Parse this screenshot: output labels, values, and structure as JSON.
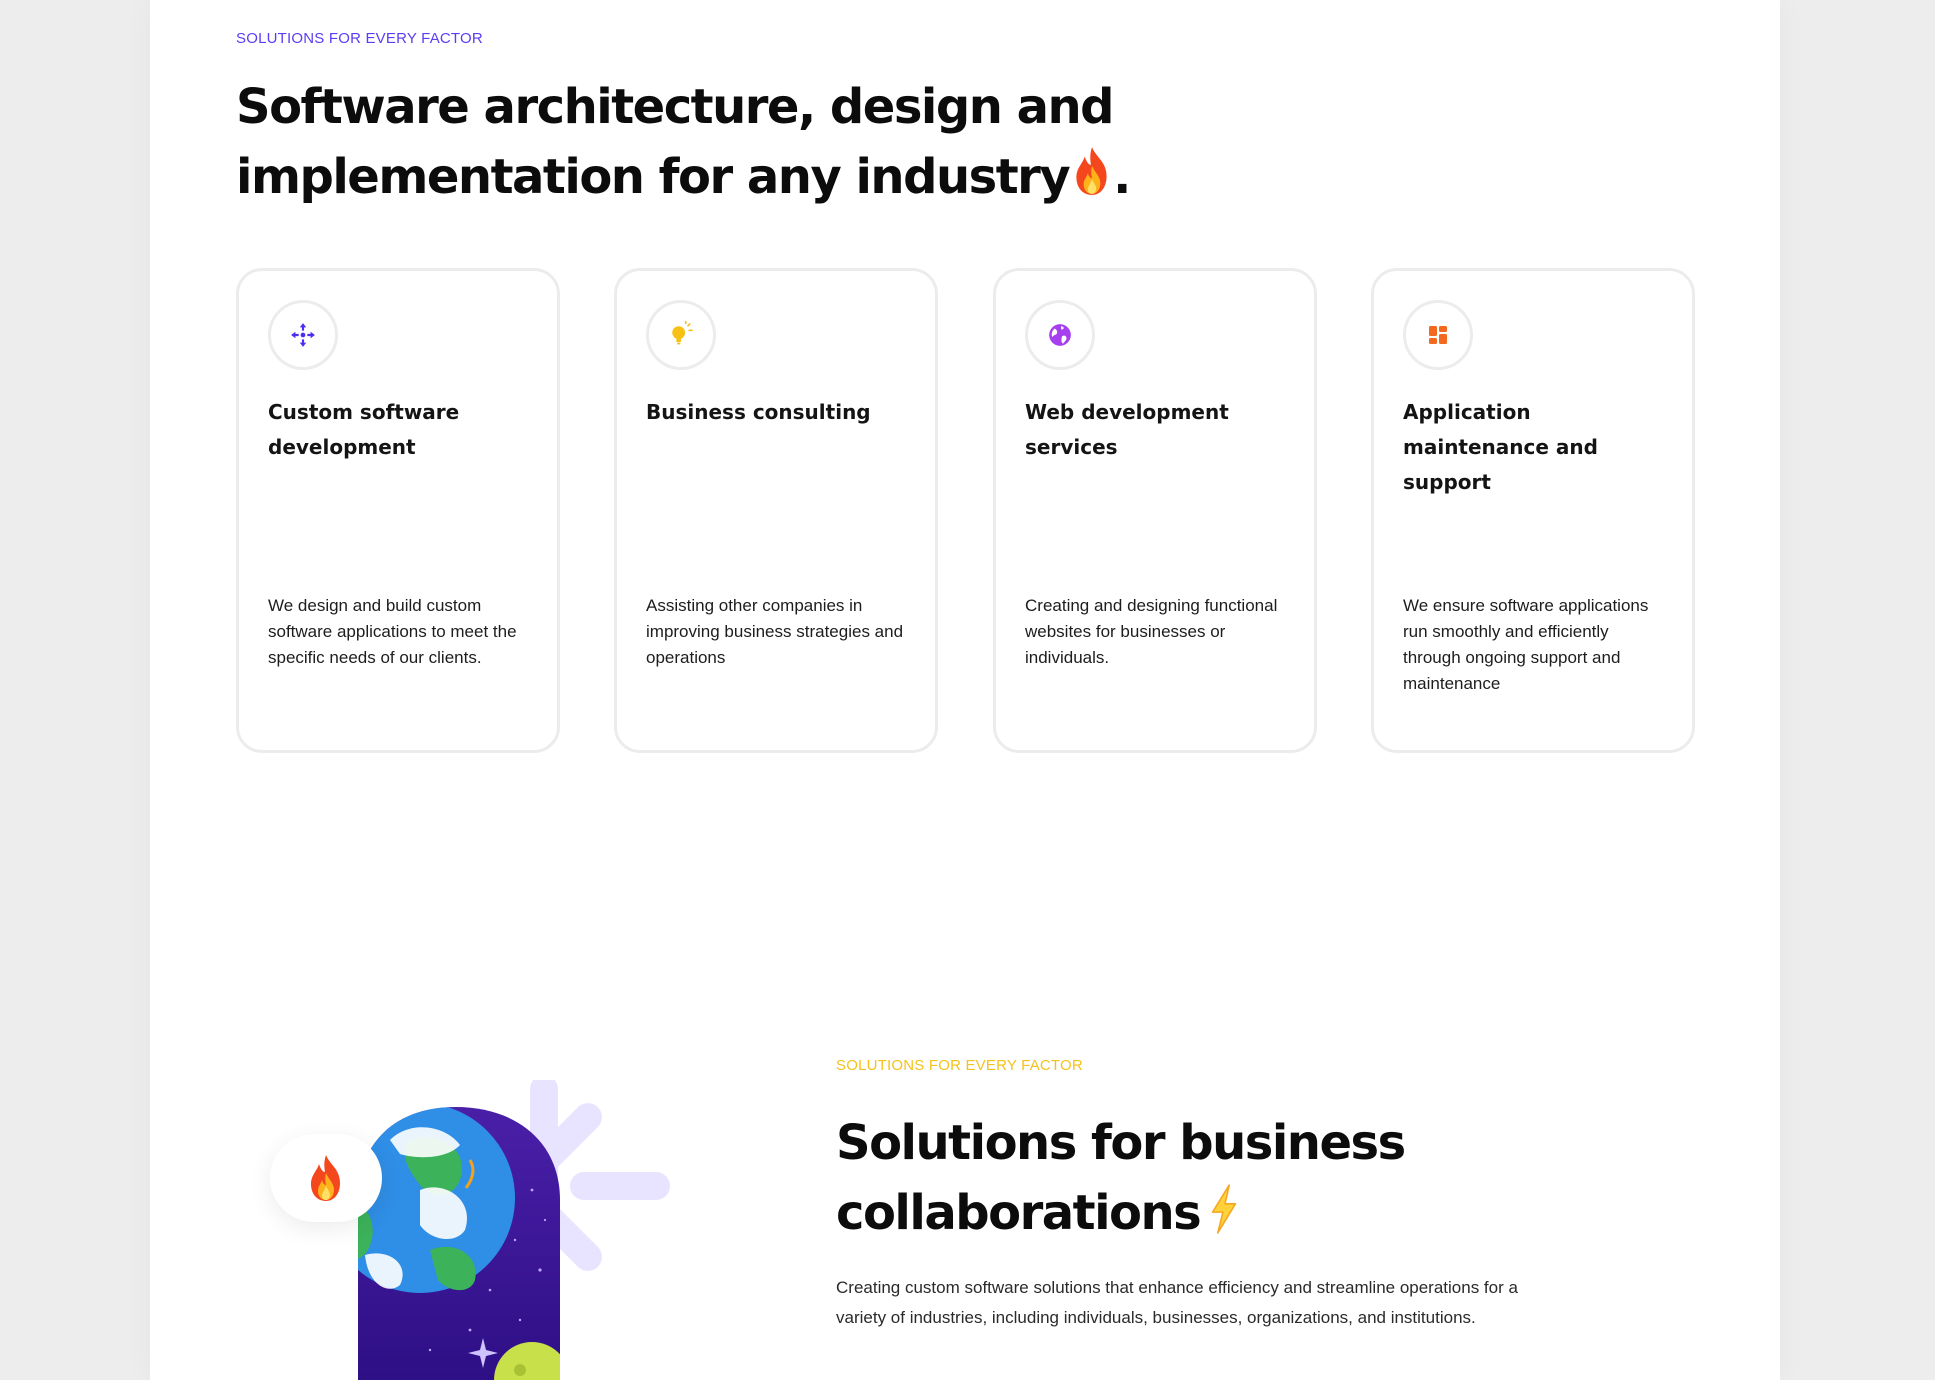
{
  "section1": {
    "eyebrow": "SOLUTIONS FOR EVERY FACTOR",
    "headline": "Software architecture, design and implementation for any industry",
    "headline_emoji": "fire-emoji",
    "headline_suffix": ".",
    "cards": [
      {
        "icon": "move-arrows-icon",
        "icon_color": "#4a2ff0",
        "title": "Custom software development",
        "description": "We design and build custom software applications to meet the specific needs of our clients."
      },
      {
        "icon": "lightbulb-icon",
        "icon_color": "#f6c015",
        "title": "Business consulting",
        "description": "Assisting other companies in improving business strategies and operations"
      },
      {
        "icon": "globe-icon",
        "icon_color": "#a63ff0",
        "title": "Web development services",
        "description": "Creating and designing functional websites for businesses or individuals."
      },
      {
        "icon": "dashboard-grid-icon",
        "icon_color": "#f36a1e",
        "title": "Application maintenance and support",
        "description": "We ensure software applications run smoothly and efficiently through ongoing support and maintenance"
      }
    ]
  },
  "section2": {
    "eyebrow": "SOLUTIONS FOR EVERY FACTOR",
    "headline": "Solutions for business collaborations",
    "headline_emoji": "lightning-emoji",
    "description": "Creating custom software solutions that enhance efficiency and streamline operations for a variety of industries, including individuals, businesses, organizations, and institutions.",
    "illustration": {
      "bubble_icon": "fire-emoji",
      "image": "space-planet-illustration"
    }
  },
  "colors": {
    "accent_purple": "#5b3df5",
    "accent_yellow": "#f5c21b",
    "text_dark": "#0c0c0c",
    "card_border": "#ececec",
    "page_bg": "#ededed"
  }
}
